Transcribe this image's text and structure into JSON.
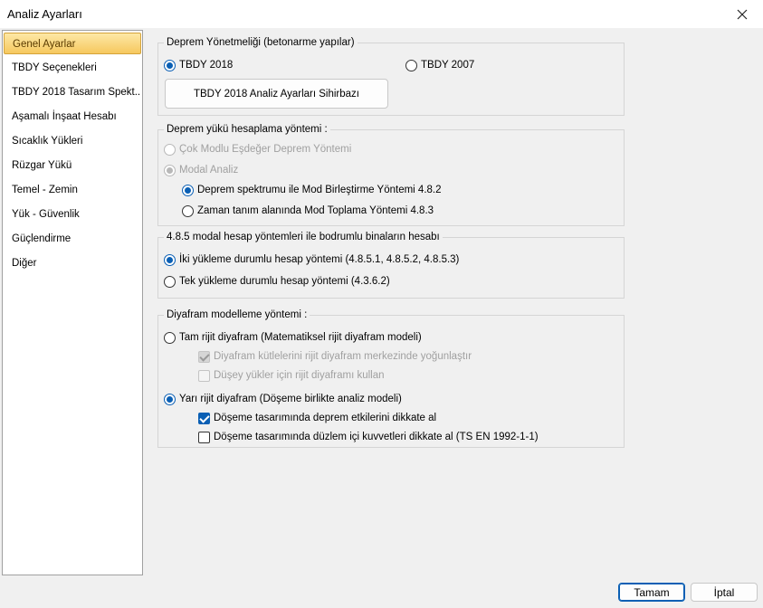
{
  "window": {
    "title": "Analiz Ayarları"
  },
  "sidebar": {
    "items": [
      {
        "label": "Genel Ayarlar"
      },
      {
        "label": "TBDY Seçenekleri"
      },
      {
        "label": "TBDY 2018 Tasarım Spekt..."
      },
      {
        "label": "Aşamalı İnşaat Hesabı"
      },
      {
        "label": "Sıcaklık Yükleri"
      },
      {
        "label": "Rüzgar Yükü"
      },
      {
        "label": "Temel - Zemin"
      },
      {
        "label": "Yük - Güvenlik"
      },
      {
        "label": "Güçlendirme"
      },
      {
        "label": "Diğer"
      }
    ],
    "selected": "Genel Ayarlar"
  },
  "regulation": {
    "title": "Deprem Yönetmeliği (betonarme yapılar)",
    "tbdy2018": "TBDY 2018",
    "tbdy2007": "TBDY 2007",
    "selected": "TBDY 2018",
    "wizard_button": "TBDY 2018 Analiz Ayarları Sihirbazı"
  },
  "load_method": {
    "title": "Deprem yükü hesaplama yöntemi :",
    "equivalent": "Çok Modlu Eşdeğer Deprem Yöntemi",
    "modal": "Modal Analiz",
    "spectrum": "Deprem spektrumu ile Mod Birleştirme Yöntemi 4.8.2",
    "time_history": "Zaman tanım alanında Mod Toplama Yöntemi 4.8.3",
    "selected_sub": "Deprem spektrumu ile Mod Birleştirme Yöntemi 4.8.2"
  },
  "basement": {
    "title": "4.8.5 modal hesap yöntemleri ile bodrumlu binaların hesabı",
    "two_case": "İki yükleme durumlu hesap yöntemi (4.8.5.1, 4.8.5.2, 4.8.5.3)",
    "one_case": "Tek yükleme durumlu hesap yöntemi (4.3.6.2)",
    "selected": "İki yükleme durumlu hesap yöntemi (4.8.5.1, 4.8.5.2, 4.8.5.3)"
  },
  "diaphragm": {
    "title": "Diyafram modelleme yöntemi  :",
    "rigid": "Tam rijit diyafram (Matematiksel rijit diyafram modeli)",
    "rigid_mass": "Diyafram kütlelerini rijit diyafram merkezinde yoğunlaştır",
    "rigid_vertical": "Düşey yükler için rijit diyaframı kullan",
    "semi_rigid": "Yarı rijit diyafram (Döşeme birlikte analiz modeli)",
    "slab_seismic": "Döşeme tasarımında deprem etkilerini dikkate al",
    "slab_inplane": "Döşeme tasarımında düzlem içi kuvvetleri dikkate al (TS EN 1992-1-1)",
    "selected": "Yarı rijit diyafram (Döşeme birlikte analiz modeli)",
    "slab_seismic_checked": true,
    "slab_inplane_checked": false
  },
  "footer": {
    "ok": "Tamam",
    "cancel": "İptal"
  },
  "colors": {
    "accent": "#0a5fb4",
    "selection_gradient": "#f6c85e"
  }
}
